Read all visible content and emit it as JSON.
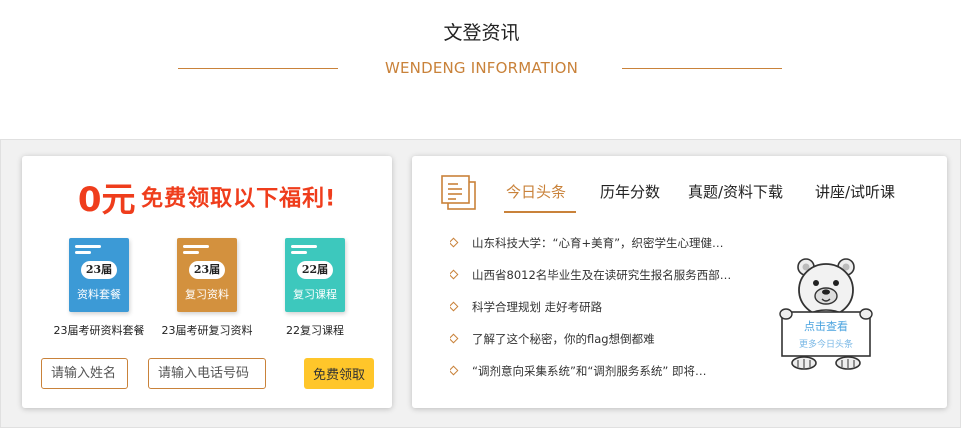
{
  "header": {
    "title": "文登资讯",
    "subtitle": "WENDENG INFORMATION"
  },
  "promo": {
    "price": "0元",
    "text": "免费领取以下福利!"
  },
  "books": [
    {
      "badge": "23届",
      "name": "资料套餐",
      "caption": "23届考研资料套餐",
      "color": "#3c9ad6"
    },
    {
      "badge": "23届",
      "name": "复习资料",
      "caption": "23届考研复习资料",
      "color": "#d3913e"
    },
    {
      "badge": "22届",
      "name": "复习课程",
      "caption": "22复习课程",
      "color": "#3dc8bd"
    }
  ],
  "form": {
    "name_placeholder": "请输入姓名",
    "phone_placeholder": "请输入电话号码",
    "submit_label": "免费领取"
  },
  "tabs": [
    {
      "label": "今日头条",
      "active": true
    },
    {
      "label": "历年分数",
      "active": false
    },
    {
      "label": "真题/资料下载",
      "active": false
    },
    {
      "label": "讲座/试听课",
      "active": false
    }
  ],
  "news": [
    "山东科技大学：“心育+美育”，织密学生心理健…",
    "山西省8012名毕业生及在读研究生报名服务西部…",
    "科学合理规划 走好考研路",
    "了解了这个秘密，你的flag想倒都难",
    "“调剂意向采集系统”和“调剂服务系统” 即将…"
  ],
  "mascot": {
    "line1": "点击查看",
    "line2": "更多今日头条"
  },
  "colors": {
    "accent": "#c9823a",
    "promo_red": "#ef3d1c",
    "button_yellow": "#ffc62a",
    "mascot_blue": "#4aa3df"
  }
}
